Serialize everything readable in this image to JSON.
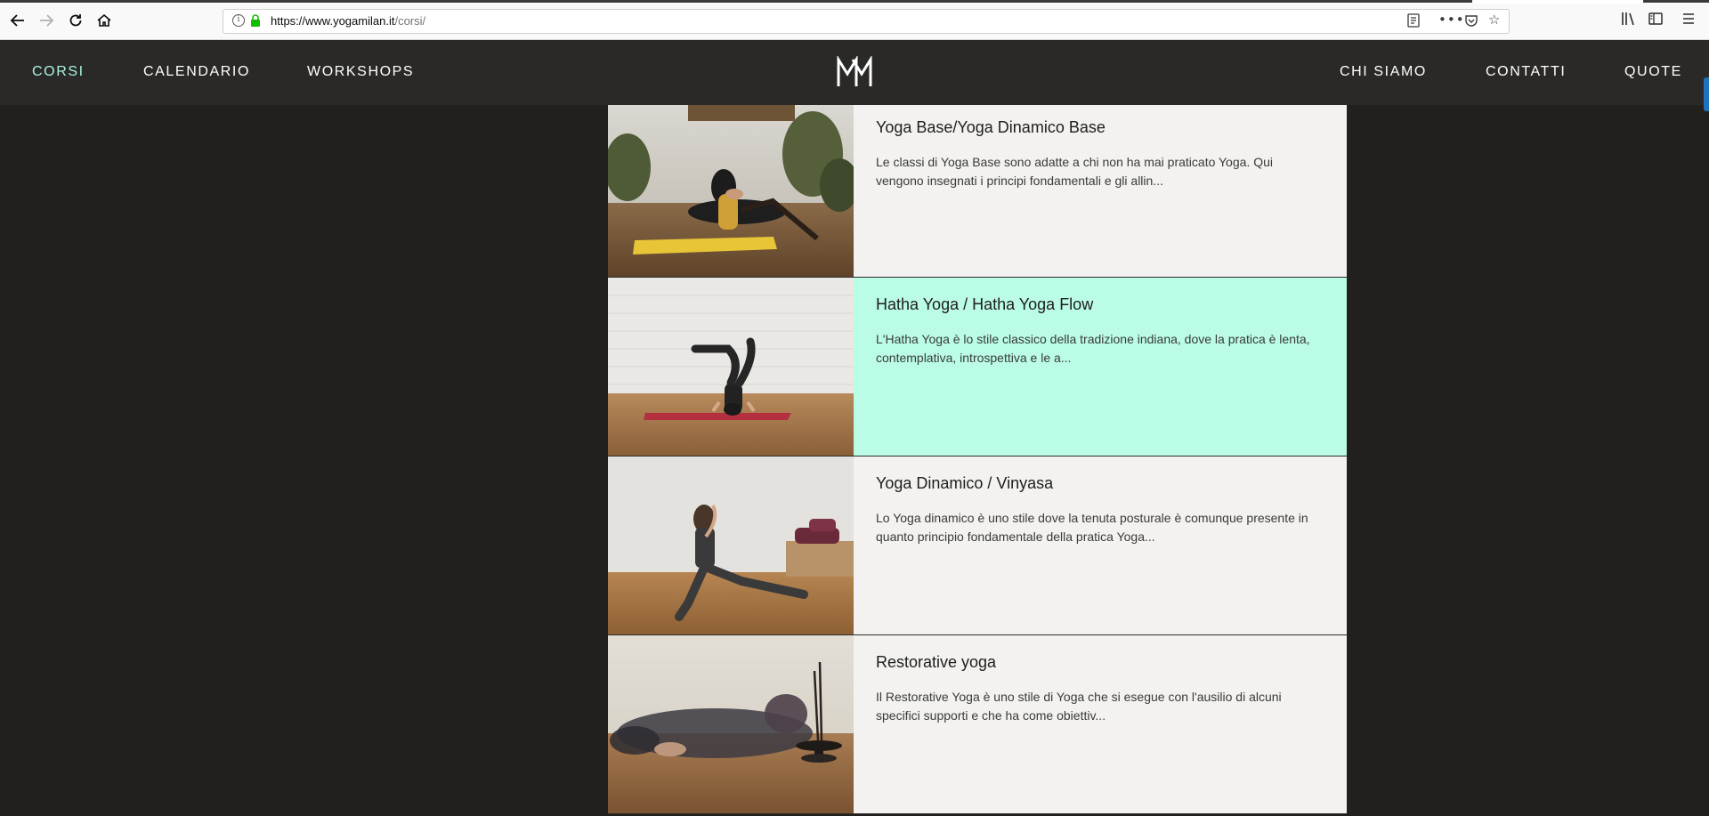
{
  "browser": {
    "url_domain": "https://www.yogamilan.it",
    "url_path": "/corsi/",
    "icons": [
      "back-icon",
      "forward-icon",
      "reload-icon",
      "home-icon",
      "info-icon",
      "lock-icon",
      "reader-view-icon",
      "page-actions-icon",
      "pocket-icon",
      "bookmark-star-icon",
      "library-icon",
      "sidebar-icon",
      "menu-icon"
    ]
  },
  "header": {
    "nav_left": [
      "CORSI",
      "CALENDARIO",
      "WORKSHOPS"
    ],
    "nav_right": [
      "CHI SIAMO",
      "CONTATTI",
      "QUOTE"
    ],
    "active_item": "CORSI",
    "logo_letters": "YM",
    "accent_color": "#a8f5df"
  },
  "courses": [
    {
      "title": "Yoga Base/Yoga Dinamico Base",
      "description": "Le classi di Yoga Base sono adatte a chi non ha mai praticato Yoga. Qui vengono insegnati i principi fondamentali e gli allin...",
      "highlighted": false
    },
    {
      "title": "Hatha Yoga / Hatha Yoga Flow",
      "description": "L'Hatha Yoga è lo stile classico della tradizione indiana, dove la pratica è lenta, contemplativa, introspettiva e le a...",
      "highlighted": true
    },
    {
      "title": "Yoga Dinamico / Vinyasa",
      "description": "Lo Yoga dinamico è uno stile dove la tenuta posturale è comunque presente in quanto principio fondamentale della pratica Yoga...",
      "highlighted": false
    },
    {
      "title": "Restorative yoga",
      "description": "Il Restorative Yoga è uno stile di Yoga che si esegue con l'ausilio di alcuni specifici supporti e che ha come obiettiv...",
      "highlighted": false
    }
  ],
  "colors": {
    "page_background": "#21201d",
    "header_background": "#2a2927",
    "card_background": "#f3f2f0",
    "card_highlight": "#bafce6"
  }
}
